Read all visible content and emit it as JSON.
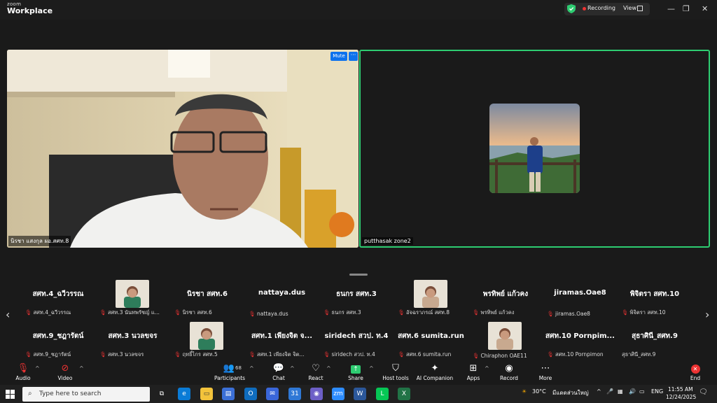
{
  "app": {
    "brand_top": "zoom",
    "brand_bottom": "Workplace"
  },
  "titlebar": {
    "recording_label": "Recording",
    "view_label": "View"
  },
  "colors": {
    "accent_blue": "#0e72ed",
    "active_speaker_border": "#2ecc71",
    "recording_red": "#ee3333"
  },
  "main_video": {
    "name_label": "นิรชา แสงกุล ผอ.สศท.8",
    "mute_button": "Mute",
    "more_button": "···"
  },
  "second_video": {
    "name_label": "putthasak zone2"
  },
  "gallery": {
    "row1": [
      {
        "display": "สศท.4_ฉวีวรรณ",
        "label": "สศท.4_ฉวีวรรณ",
        "has_video": false
      },
      {
        "display": "",
        "label": "สศท.3 นันทพรัชญ์ แ...",
        "has_video": true
      },
      {
        "display": "นิรชา สศท.6",
        "label": "นิรชา สศท.6",
        "has_video": false
      },
      {
        "display": "nattaya.dus",
        "label": "nattaya.dus",
        "has_video": false
      },
      {
        "display": "ธนกร สศท.3",
        "label": "ธนกร สศท.3",
        "has_video": false
      },
      {
        "display": "",
        "label": "อัจฉราภรณ์ สศท.8",
        "has_video": true
      },
      {
        "display": "พรทิพย์ แก้วคง",
        "label": "พรทิพย์ แก้วคง",
        "has_video": false
      },
      {
        "display": "jiramas.Oae8",
        "label": "jiramas.Oae8",
        "has_video": false
      },
      {
        "display": "พิจิตรา สศท.10",
        "label": "พิจิตรา สศท.10",
        "has_video": false
      }
    ],
    "row2": [
      {
        "display": "สศท.9_ชฎารัตน์",
        "label": "สศท.9_ชฎารัตน์",
        "has_video": false
      },
      {
        "display": "สศท.3 นวลขจร",
        "label": "สศท.3 นวลขจร",
        "has_video": false
      },
      {
        "display": "",
        "label": "ฤทธิ์ไกร สศท.5",
        "has_video": true
      },
      {
        "display": "สศท.1 เพียงจิต จ...",
        "label": "สศท.1 เพียงจิต จิต...",
        "has_video": false
      },
      {
        "display": "siridech สวป. ท.4",
        "label": "siridech สวป. ท.4",
        "has_video": false
      },
      {
        "display": "สศท.6 sumita.run",
        "label": "สศท.6 sumita.run",
        "has_video": false
      },
      {
        "display": "",
        "label": "Chiraphon OAE11",
        "has_video": true
      },
      {
        "display": "สศท.10 Pornpim...",
        "label": "สศท.10 Pornpimon",
        "has_video": false
      },
      {
        "display": "สุธาศินี_สศท.9",
        "label": "สุธาศินี_สศท.9",
        "has_video": false,
        "no_mic": true
      }
    ]
  },
  "toolbar": {
    "audio": "Audio",
    "video": "Video",
    "participants": "Participants",
    "participants_count": "68",
    "chat": "Chat",
    "react": "React",
    "share": "Share",
    "host_tools": "Host tools",
    "ai_companion": "AI Companion",
    "apps": "Apps",
    "record": "Record",
    "more": "More",
    "end": "End"
  },
  "taskbar": {
    "search_placeholder": "Type here to search",
    "weather_temp": "30°C",
    "weather_text": "มีแดดส่วนใหญ่",
    "lang": "ENG",
    "time": "11:55 AM",
    "date": "12/24/2025"
  }
}
